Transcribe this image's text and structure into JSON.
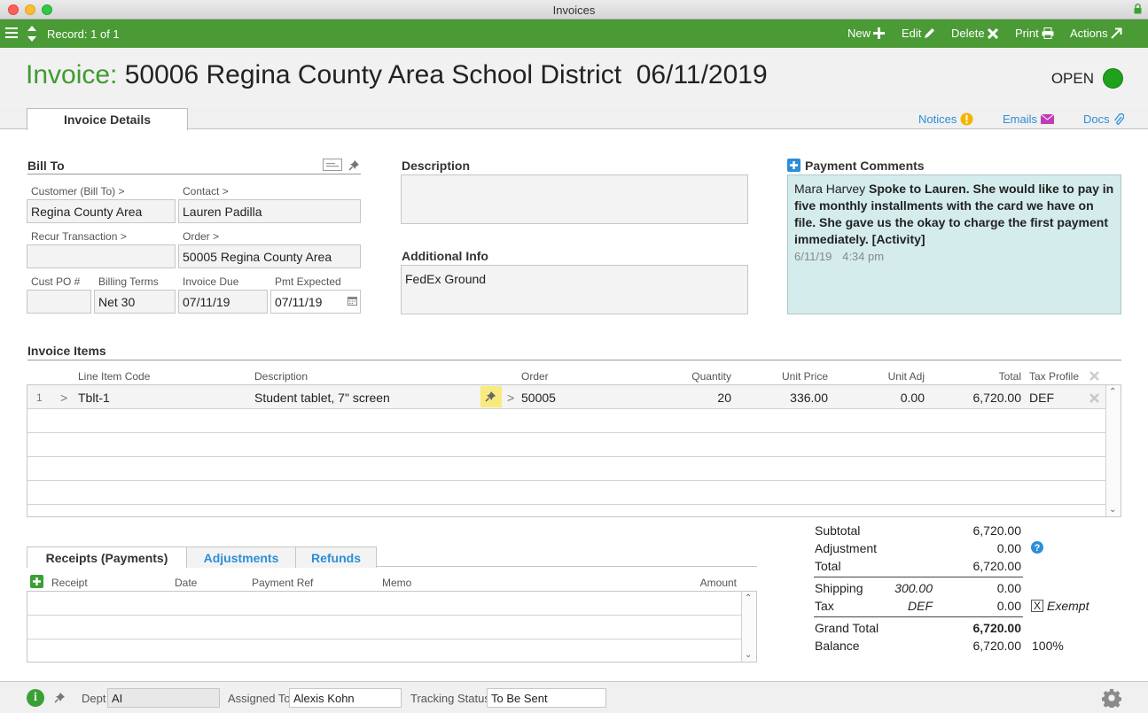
{
  "window": {
    "title": "Invoices"
  },
  "toolbar": {
    "record_label": "Record: 1 of 1",
    "new_label": "New",
    "edit_label": "Edit",
    "delete_label": "Delete",
    "print_label": "Print",
    "actions_label": "Actions"
  },
  "header": {
    "prefix": "Invoice:",
    "title": "50006 Regina County Area School District",
    "date": "06/11/2019",
    "status": "OPEN",
    "status_color": "#1ea21e"
  },
  "tabs": {
    "invoice_details": "Invoice Details",
    "notices": "Notices",
    "emails": "Emails",
    "docs": "Docs"
  },
  "bill_to": {
    "title": "Bill To",
    "customer_label": "Customer (Bill To) >",
    "customer": "Regina County Area",
    "contact_label": "Contact >",
    "contact": "Lauren Padilla",
    "recur_label": "Recur Transaction >",
    "recur": "",
    "order_label": "Order >",
    "order": "50005 Regina County Area",
    "custpo_label": "Cust PO #",
    "custpo": "",
    "terms_label": "Billing Terms",
    "terms": "Net 30",
    "due_label": "Invoice Due",
    "due": "07/11/19",
    "pmt_label": "Pmt Expected",
    "pmt": "07/11/19"
  },
  "description": {
    "title": "Description",
    "value": ""
  },
  "additional": {
    "title": "Additional Info",
    "value": "FedEx Ground"
  },
  "payment_comments": {
    "title": "Payment Comments",
    "author": "Mara Harvey",
    "text": "Spoke to Lauren. She would like to pay in five monthly installments with the card we have on file. She gave us the okay to charge the first payment immediately. [Activity]",
    "date": "6/11/19",
    "time": "4:34 pm"
  },
  "items": {
    "title": "Invoice Items",
    "headers": {
      "code": "Line Item Code",
      "desc": "Description",
      "order": "Order",
      "qty": "Quantity",
      "price": "Unit Price",
      "adj": "Unit Adj",
      "total": "Total",
      "tax": "Tax Profile"
    },
    "rows": [
      {
        "num": "1",
        "code": "Tblt-1",
        "desc": "Student tablet, 7\" screen",
        "order": "50005",
        "qty": "20",
        "price": "336.00",
        "adj": "0.00",
        "total": "6,720.00",
        "tax": "DEF"
      }
    ]
  },
  "totals": {
    "subtotal_label": "Subtotal",
    "subtotal": "6,720.00",
    "adjustment_label": "Adjustment",
    "adjustment": "0.00",
    "total_label": "Total",
    "total": "6,720.00",
    "shipping_label": "Shipping",
    "shipping_input": "300.00",
    "shipping": "0.00",
    "tax_label": "Tax",
    "tax_profile": "DEF",
    "tax": "0.00",
    "exempt_label": "Exempt",
    "exempt_checked": "X",
    "grand_label": "Grand Total",
    "grand": "6,720.00",
    "balance_label": "Balance",
    "balance": "6,720.00",
    "balance_pct": "100%"
  },
  "receipts": {
    "tabs": [
      "Receipts (Payments)",
      "Adjustments",
      "Refunds"
    ],
    "headers": {
      "receipt": "Receipt",
      "date": "Date",
      "ref": "Payment Ref",
      "memo": "Memo",
      "amount": "Amount"
    }
  },
  "footer": {
    "dept_label": "Dept",
    "dept": "AI",
    "assigned_label": "Assigned To",
    "assigned": "Alexis Kohn",
    "tracking_label": "Tracking Status",
    "tracking": "To Be Sent"
  }
}
